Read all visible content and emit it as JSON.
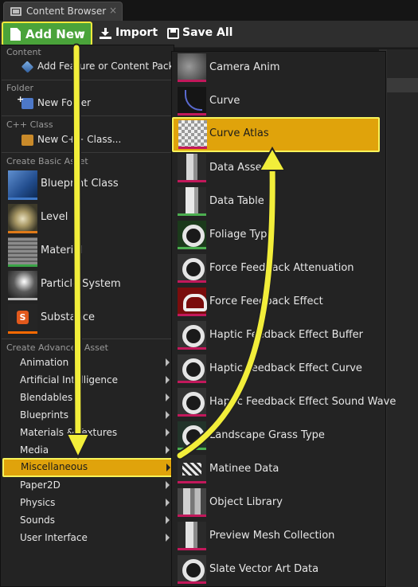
{
  "window": {
    "tab_label": "Content Browser",
    "tab_close": "×"
  },
  "toolbar": {
    "add_new_label": "Add New",
    "add_new_caret": "▾",
    "import_label": "Import",
    "save_all_label": "Save All"
  },
  "menu": {
    "sections": {
      "content": "Content",
      "folder": "Folder",
      "cpp": "C++ Class",
      "basic": "Create Basic Asset",
      "advanced": "Create Advanced Asset"
    },
    "content_item": "Add Feature or Content Pack...",
    "folder_item": "New Folder",
    "cpp_item": "New C++ Class...",
    "basic_items": [
      "Blueprint Class",
      "Level",
      "Material",
      "Particle System",
      "Substance"
    ],
    "advanced_items": [
      "Animation",
      "Artificial Intelligence",
      "Blendables",
      "Blueprints",
      "Materials & Textures",
      "Media",
      "Miscellaneous",
      "Paper2D",
      "Physics",
      "Sounds",
      "User Interface"
    ],
    "selected_advanced": "Miscellaneous"
  },
  "submenu": {
    "items": [
      "Camera Anim",
      "Curve",
      "Curve Atlas",
      "Data Asset",
      "Data Table",
      "Foliage Type",
      "Force Feedback Attenuation",
      "Force Feedback Effect",
      "Haptic Feedback Effect Buffer",
      "Haptic Feedback Effect Curve",
      "Haptic Feedback Effect Sound Wave",
      "Landscape Grass Type",
      "Matinee Data",
      "Object Library",
      "Preview Mesh Collection",
      "Slate Vector Art Data"
    ],
    "selected": "Curve Atlas"
  },
  "colors": {
    "highlight": "#e0a30b",
    "highlight_border": "#f7f35a",
    "add_new_green": "#4aa33a",
    "annotation_arrow": "#f2ee3a"
  },
  "icons": {
    "tab": "content-browser-icon",
    "add_new": "document-icon",
    "import": "import-icon",
    "save_all": "save-icon"
  }
}
